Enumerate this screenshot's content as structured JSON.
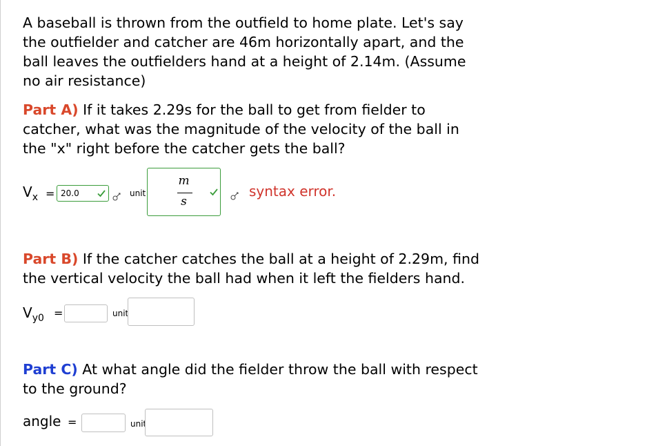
{
  "problem": {
    "intro_lines": [
      "A baseball is thrown from the outfield to home plate.  Let's say",
      "the outfielder and catcher are 46m horizontally apart, and the",
      "ball leaves the outfielders hand at a height of 2.14m.  (Assume",
      "no air resistance)"
    ]
  },
  "partA": {
    "label": "Part A)",
    "text_lines": [
      " If it takes 2.29s for the ball to get from fielder to",
      "catcher, what was the magnitude of the velocity of the ball in",
      "the \"x\" right before the catcher gets the ball?"
    ],
    "var_main": "V",
    "var_sub": "x",
    "equals": "=",
    "value": "20.0",
    "unit_label": "unit",
    "unit_numerator": "m",
    "unit_denominator": "s",
    "error": "syntax error."
  },
  "partB": {
    "label": "Part B)",
    "text_lines": [
      " If the catcher catches the ball at a height of 2.29m, find",
      "the vertical velocity the ball had when it left the fielders hand."
    ],
    "var_main": "V",
    "var_sub": "y0",
    "equals": "=",
    "value": "",
    "unit_label": "unit"
  },
  "partC": {
    "label": "Part C)",
    "text_lines": [
      " At what angle did the fielder throw the ball with respect",
      "to the ground?"
    ],
    "var_main": "angle",
    "equals": "=",
    "value": "",
    "unit_label": "unit"
  },
  "colors": {
    "part_label": "#d9482b",
    "part_c_label": "#1f3fd2",
    "correct": "#3a9c3a",
    "error": "#d0342c"
  },
  "icons": {
    "check": "check-icon",
    "clear": "eraser-icon"
  }
}
